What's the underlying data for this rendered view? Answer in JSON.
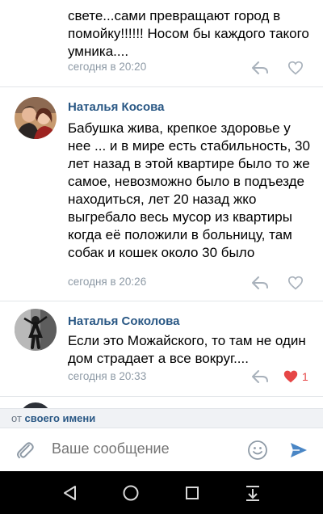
{
  "comments": [
    {
      "text": "свете...сами превращают город в помойку!!!!!! Носом бы каждого такого умника....",
      "time": "сегодня в 20:20",
      "likes": ""
    },
    {
      "author": "Наталья Косова",
      "text": "Бабушка жива, крепкое здоровье у нее ... и в мире есть стабильность, 30 лет назад в этой квартире было то же самое, невозможно было в подъезде  находиться, лет 20 назад жко выгребало весь мусор из квартиры когда её положили в больницу,  там собак и кошек около 30 было",
      "time": "сегодня в 20:26",
      "likes": ""
    },
    {
      "author": "Наталья Соколова",
      "text": "Если это Можайского, то там не один дом страдает а все вокруг....",
      "time": "сегодня в 20:33",
      "likes": "1",
      "liked": true
    }
  ],
  "reply_bar": {
    "prefix": "от",
    "link": "своего имени"
  },
  "composer": {
    "placeholder": "Ваше сообщение"
  },
  "icons": {
    "reply": "reply-arrow-icon",
    "like": "heart-icon",
    "attach": "paperclip-icon",
    "emoji": "smiley-icon",
    "send": "send-icon",
    "back": "triangle-back-icon",
    "home": "circle-home-icon",
    "recents": "square-recents-icon",
    "hide_keyboard": "hide-keyboard-icon"
  },
  "colors": {
    "accent": "#2a5885",
    "muted": "#8e9aa6",
    "like": "#e64646",
    "send": "#4a86c5"
  }
}
